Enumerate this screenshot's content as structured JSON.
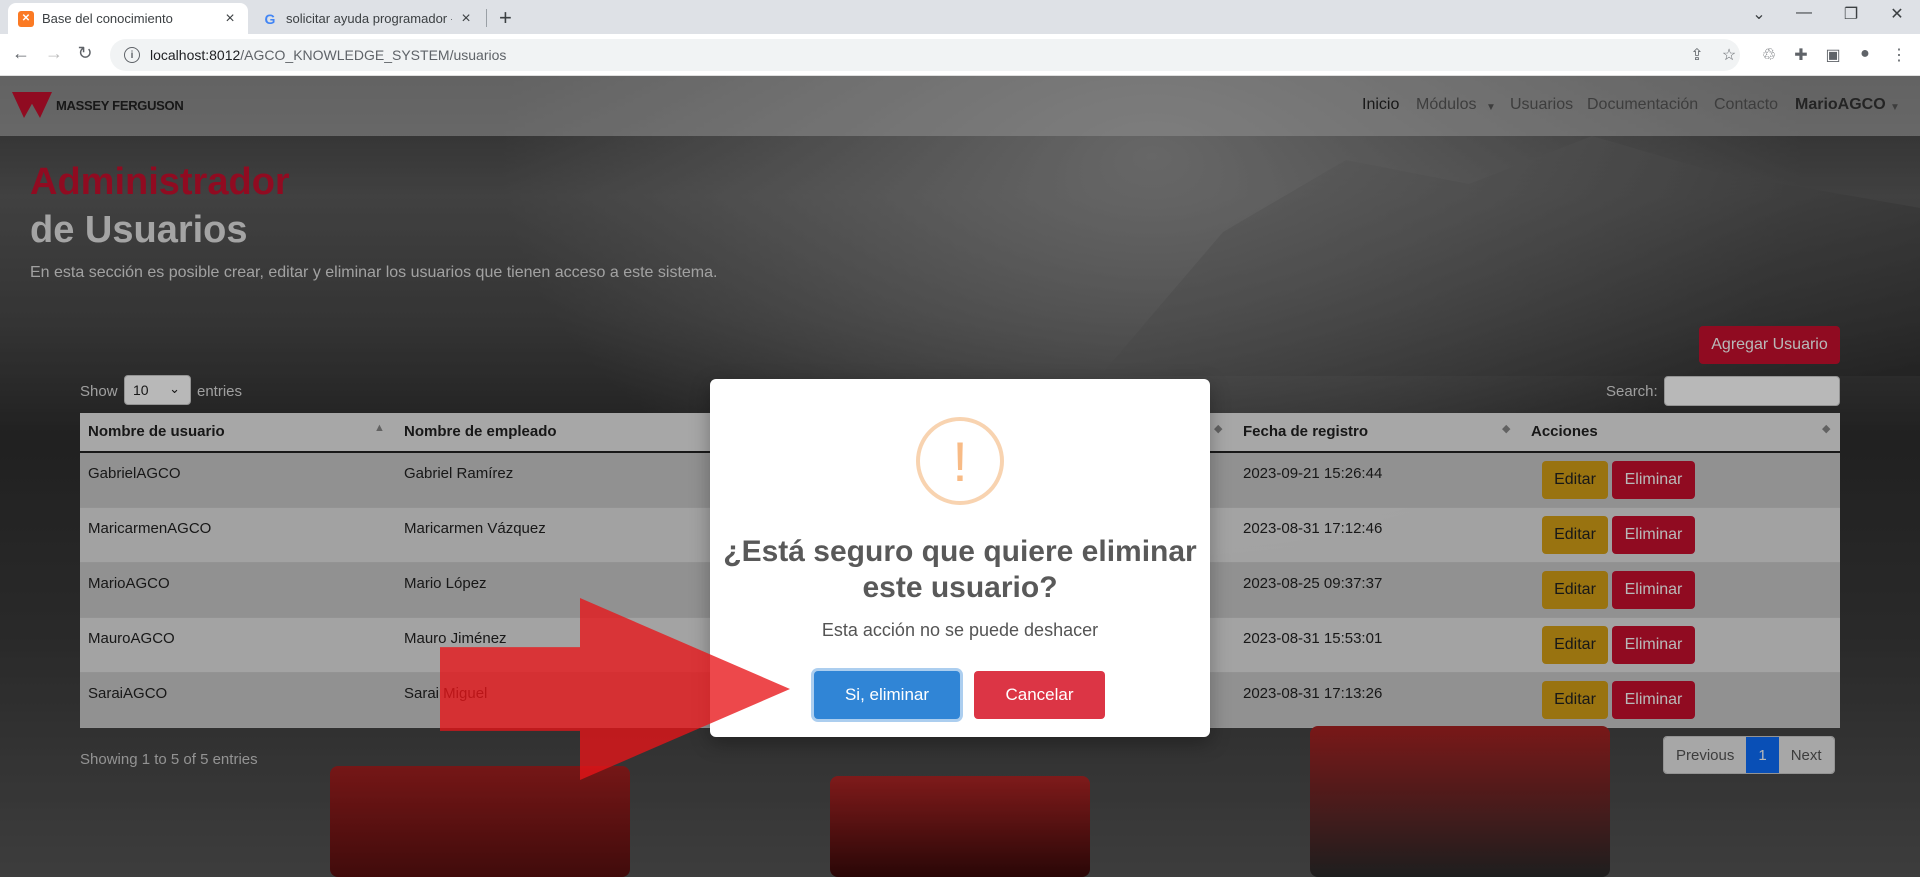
{
  "browser": {
    "tabs": [
      {
        "title": "Base del conocimiento",
        "active": true
      },
      {
        "title": "solicitar ayuda programador - Bú",
        "active": false
      }
    ],
    "url_host": "localhost:8012",
    "url_path": "/AGCO_KNOWLEDGE_SYSTEM/usuarios"
  },
  "nav": {
    "brand": "MASSEY FERGUSON",
    "items": [
      "Inicio",
      "Módulos",
      "Usuarios",
      "Documentación",
      "Contacto"
    ],
    "user": "MarioAGCO"
  },
  "hero": {
    "title_line1": "Administrador",
    "title_line2": "de Usuarios",
    "description": "En esta sección es posible crear, editar y eliminar los usuarios que tienen acceso a este sistema."
  },
  "add_button": "Agregar Usuario",
  "table_controls": {
    "show_label": "Show",
    "page_size": "10",
    "entries_label": "entries",
    "search_label": "Search:"
  },
  "table": {
    "headers": [
      "Nombre de usuario",
      "Nombre de empleado",
      "Fecha de registro",
      "Acciones"
    ],
    "rows": [
      {
        "user": "GabrielAGCO",
        "employee": "Gabriel Ramírez",
        "date": "2023-09-21 15:26:44"
      },
      {
        "user": "MaricarmenAGCO",
        "employee": "Maricarmen Vázquez",
        "date": "2023-08-31 17:12:46"
      },
      {
        "user": "MarioAGCO",
        "employee": "Mario López",
        "date": "2023-08-25 09:37:37"
      },
      {
        "user": "MauroAGCO",
        "employee": "Mauro Jiménez",
        "date": "2023-08-31 15:53:01"
      },
      {
        "user": "SaraiAGCO",
        "employee": "Sarai Miguel",
        "date": "2023-08-31 17:13:26"
      }
    ],
    "edit_label": "Editar",
    "delete_label": "Eliminar"
  },
  "footer": {
    "info": "Showing 1 to 5 of 5 entries",
    "prev": "Previous",
    "current": "1",
    "next": "Next"
  },
  "modal": {
    "icon": "!",
    "title": "¿Está seguro que quiere eliminar este usuario?",
    "text": "Esta acción no se puede deshacer",
    "confirm": "Si, eliminar",
    "cancel": "Cancelar"
  },
  "colors": {
    "brand_red": "#c8102e",
    "confirm_blue": "#3085d6",
    "cancel_red": "#dc3545",
    "edit_yellow": "#d4a017"
  }
}
